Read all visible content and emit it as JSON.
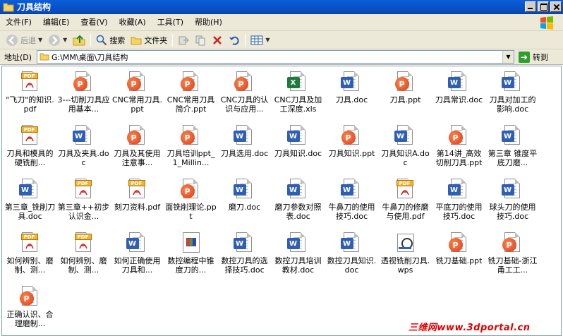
{
  "window": {
    "title": "刀具结构"
  },
  "menu": [
    "文件(F)",
    "编辑(E)",
    "查看(V)",
    "收藏(A)",
    "工具(T)",
    "帮助(H)"
  ],
  "toolbar": {
    "back": "后退",
    "search": "搜索",
    "folders": "文件夹"
  },
  "address": {
    "label": "地址(D)",
    "path": "G:\\MM\\桌面\\刀具结构",
    "go": "转到"
  },
  "files": [
    {
      "name": "\"飞刀\"的知识.pdf",
      "type": "pdf"
    },
    {
      "name": "3---切削刀具应用基本...",
      "type": "ppt"
    },
    {
      "name": "CNC常用刀具.ppt",
      "type": "ppt"
    },
    {
      "name": "CNC常用刀具简介.ppt",
      "type": "ppt"
    },
    {
      "name": "CNC刀具的认识与应用...",
      "type": "ppt"
    },
    {
      "name": "CNC刀具及加工深度.xls",
      "type": "xls"
    },
    {
      "name": "刀具.doc",
      "type": "doc"
    },
    {
      "name": "刀具.ppt",
      "type": "ppt"
    },
    {
      "name": "刀具常识.doc",
      "type": "doc"
    },
    {
      "name": "刀具对加工的影响.doc",
      "type": "doc"
    },
    {
      "name": "刀具和模具的硬铣削...",
      "type": "pdf"
    },
    {
      "name": "刀具及夹具.doc",
      "type": "doc"
    },
    {
      "name": "刀具及其使用注意事...",
      "type": "ppt"
    },
    {
      "name": "刀具培训ppt_1_Millin...",
      "type": "ppt"
    },
    {
      "name": "刀具选用.doc",
      "type": "doc"
    },
    {
      "name": "刀具知识.doc",
      "type": "doc"
    },
    {
      "name": "刀具知识.ppt",
      "type": "ppt"
    },
    {
      "name": "刀具知识A.doc",
      "type": "doc"
    },
    {
      "name": "第14讲_高效切削刀具.ppt",
      "type": "ppt"
    },
    {
      "name": "第三章 锥度平底刀磨...",
      "type": "doc"
    },
    {
      "name": "第三章_铣削刀具.doc",
      "type": "doc"
    },
    {
      "name": "第三章++初步认识金...",
      "type": "pdf"
    },
    {
      "name": "刻刀资料.pdf",
      "type": "pdf"
    },
    {
      "name": "面铣削理论.ppt",
      "type": "ppt"
    },
    {
      "name": "磨刀.doc",
      "type": "doc"
    },
    {
      "name": "磨刀参数对照表.doc",
      "type": "doc"
    },
    {
      "name": "牛鼻刀的使用技巧.doc",
      "type": "doc"
    },
    {
      "name": "牛鼻刀的修磨与使用.pdf",
      "type": "pdf"
    },
    {
      "name": "平底刀的使用技巧.doc",
      "type": "doc"
    },
    {
      "name": "球头刀的使用技巧.doc",
      "type": "doc"
    },
    {
      "name": "如何辨别、磨制、测...",
      "type": "pdf"
    },
    {
      "name": "如何辨别、磨制、测...",
      "type": "pdf"
    },
    {
      "name": "如何正确使用刀具和...",
      "type": "doc"
    },
    {
      "name": "数控编程中锥度刀的...",
      "type": "generic"
    },
    {
      "name": "数控刀具的选择技巧.doc",
      "type": "doc"
    },
    {
      "name": "数控刀具培训教材.doc",
      "type": "doc"
    },
    {
      "name": "数控刀具知识.doc",
      "type": "doc"
    },
    {
      "name": "透视铣削刀具.wps",
      "type": "wps"
    },
    {
      "name": "铣刀基础.ppt",
      "type": "ppt"
    },
    {
      "name": "铣刀基础-浙江甬工工...",
      "type": "ppt"
    },
    {
      "name": "正确认识、合理磨制...",
      "type": "ppt"
    }
  ],
  "watermark": "三维网www.3dportal.cn",
  "colors": {
    "titlebar": "#0a5fd8",
    "chrome": "#ece9d8",
    "watermark": "#e00000"
  }
}
